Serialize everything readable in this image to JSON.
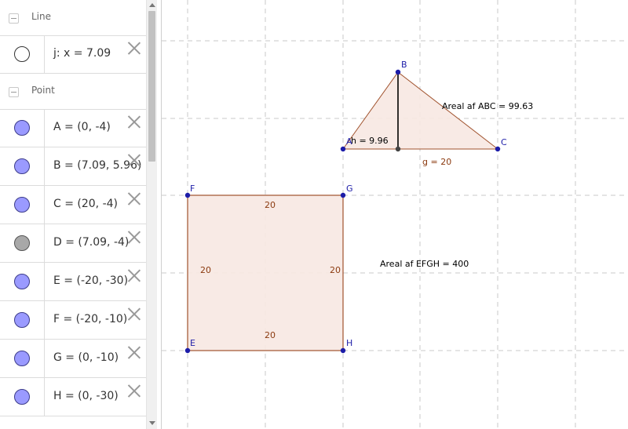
{
  "algebra": {
    "groups": [
      {
        "label": "Line",
        "items": [
          {
            "text": "j: x = 7.09",
            "marble": "empty"
          }
        ]
      },
      {
        "label": "Point",
        "items": [
          {
            "text": "A = (0, -4)",
            "marble": "blue"
          },
          {
            "text": "B = (7.09, 5.96)",
            "marble": "blue"
          },
          {
            "text": "C = (20, -4)",
            "marble": "blue"
          },
          {
            "text": "D = (7.09, -4)",
            "marble": "gray"
          },
          {
            "text": "E = (-20, -30)",
            "marble": "blue"
          },
          {
            "text": "F = (-20, -10)",
            "marble": "blue"
          },
          {
            "text": "G = (0, -10)",
            "marble": "blue"
          },
          {
            "text": "H = (0, -30)",
            "marble": "blue"
          }
        ]
      }
    ]
  },
  "graphics": {
    "points": {
      "A": "A",
      "B": "B",
      "C": "C",
      "E": "E",
      "F": "F",
      "G": "G",
      "H": "H"
    },
    "labels": {
      "area_abc": "Areal af  ABC = 99.63",
      "area_efgh": "Areal af  EFGH = 400",
      "height": "h = 9.96",
      "base": "g = 20",
      "side_top": "20",
      "side_left": "20",
      "side_right": "20",
      "side_bottom": "20"
    },
    "colors": {
      "point": "#1c1ca8",
      "polygon_fill": "#f7e8e2",
      "polygon_stroke": "#a0522d",
      "label_brown": "#8b3a0f",
      "grid": "#c8c8c8"
    }
  }
}
